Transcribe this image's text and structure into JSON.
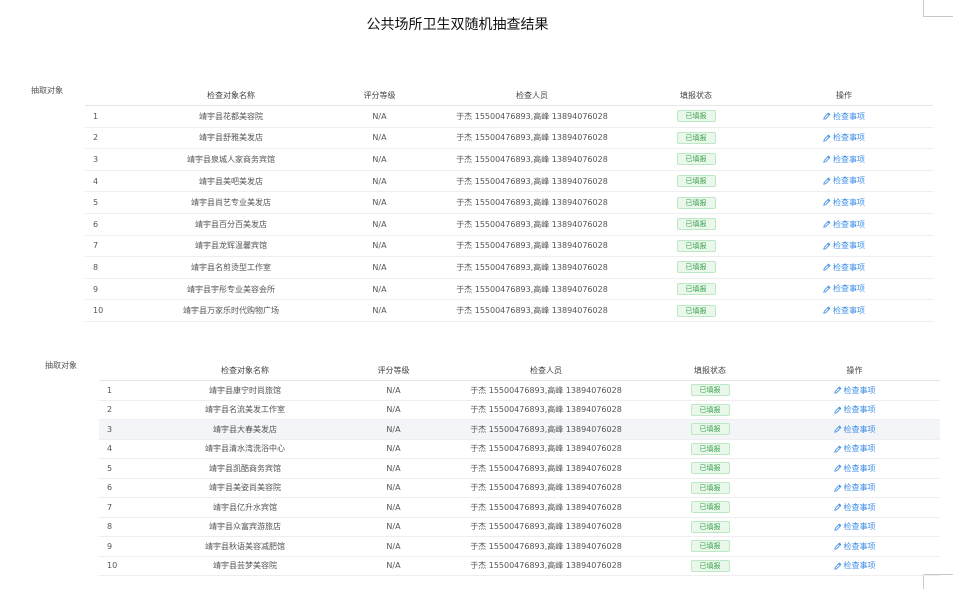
{
  "doc_title": "公共场所卫生双随机抽查结果",
  "edit_icon": "edit-icon",
  "tables": [
    {
      "label": "抽取对象",
      "headers": [
        "",
        "检查对象名称",
        "评分等级",
        "检查人员",
        "填报状态",
        "操作"
      ],
      "rows": [
        {
          "no": "1",
          "name": "靖宇县花都美容院",
          "grade": "N/A",
          "inspectors": "于杰 15500476893,高峰 13894076028",
          "status": "已填报",
          "action": "检查事项"
        },
        {
          "no": "2",
          "name": "靖宇县舒雅美发店",
          "grade": "N/A",
          "inspectors": "于杰 15500476893,高峰 13894076028",
          "status": "已填报",
          "action": "检查事项"
        },
        {
          "no": "3",
          "name": "靖宇县泉城人家商务宾馆",
          "grade": "N/A",
          "inspectors": "于杰 15500476893,高峰 13894076028",
          "status": "已填报",
          "action": "检查事项"
        },
        {
          "no": "4",
          "name": "靖宇县美吧美发店",
          "grade": "N/A",
          "inspectors": "于杰 15500476893,高峰 13894076028",
          "status": "已填报",
          "action": "检查事项"
        },
        {
          "no": "5",
          "name": "靖宇县尚艺专业美发店",
          "grade": "N/A",
          "inspectors": "于杰 15500476893,高峰 13894076028",
          "status": "已填报",
          "action": "检查事项"
        },
        {
          "no": "6",
          "name": "靖宇县百分百美发店",
          "grade": "N/A",
          "inspectors": "于杰 15500476893,高峰 13894076028",
          "status": "已填报",
          "action": "检查事项"
        },
        {
          "no": "7",
          "name": "靖宇县龙辉温馨宾馆",
          "grade": "N/A",
          "inspectors": "于杰 15500476893,高峰 13894076028",
          "status": "已填报",
          "action": "检查事项"
        },
        {
          "no": "8",
          "name": "靖宇县名剪烫型工作室",
          "grade": "N/A",
          "inspectors": "于杰 15500476893,高峰 13894076028",
          "status": "已填报",
          "action": "检查事项"
        },
        {
          "no": "9",
          "name": "靖宇县宇彤专业美容会所",
          "grade": "N/A",
          "inspectors": "于杰 15500476893,高峰 13894076028",
          "status": "已填报",
          "action": "检查事项"
        },
        {
          "no": "10",
          "name": "靖宇县万家乐时代购物广场",
          "grade": "N/A",
          "inspectors": "于杰 15500476893,高峰 13894076028",
          "status": "已填报",
          "action": "检查事项"
        }
      ]
    },
    {
      "label": "抽取对象",
      "headers": [
        "",
        "检查对象名称",
        "评分等级",
        "检查人员",
        "填报状态",
        "操作"
      ],
      "rows": [
        {
          "no": "1",
          "name": "靖宇县康宁时尚旅馆",
          "grade": "N/A",
          "inspectors": "于杰 15500476893,高峰 13894076028",
          "status": "已填报",
          "action": "检查事项"
        },
        {
          "no": "2",
          "name": "靖宇县名流美发工作室",
          "grade": "N/A",
          "inspectors": "于杰 15500476893,高峰 13894076028",
          "status": "已填报",
          "action": "检查事项"
        },
        {
          "no": "3",
          "name": "靖宇县大春美发店",
          "grade": "N/A",
          "inspectors": "于杰 15500476893,高峰 13894076028",
          "status": "已填报",
          "action": "检查事项"
        },
        {
          "no": "4",
          "name": "靖宇县清水湾洗浴中心",
          "grade": "N/A",
          "inspectors": "于杰 15500476893,高峰 13894076028",
          "status": "已填报",
          "action": "检查事项"
        },
        {
          "no": "5",
          "name": "靖宇县凯酷商务宾馆",
          "grade": "N/A",
          "inspectors": "于杰 15500476893,高峰 13894076028",
          "status": "已填报",
          "action": "检查事项"
        },
        {
          "no": "6",
          "name": "靖宇县美姿尚美容院",
          "grade": "N/A",
          "inspectors": "于杰 15500476893,高峰 13894076028",
          "status": "已填报",
          "action": "检查事项"
        },
        {
          "no": "7",
          "name": "靖宇县亿升水宾馆",
          "grade": "N/A",
          "inspectors": "于杰 15500476893,高峰 13894076028",
          "status": "已填报",
          "action": "检查事项"
        },
        {
          "no": "8",
          "name": "靖宇县众富宾游旅店",
          "grade": "N/A",
          "inspectors": "于杰 15500476893,高峰 13894076028",
          "status": "已填报",
          "action": "检查事项"
        },
        {
          "no": "9",
          "name": "靖宇县秋语美容减肥馆",
          "grade": "N/A",
          "inspectors": "于杰 15500476893,高峰 13894076028",
          "status": "已填报",
          "action": "检查事项"
        },
        {
          "no": "10",
          "name": "靖宇县芸梦美容院",
          "grade": "N/A",
          "inspectors": "于杰 15500476893,高峰 13894076028",
          "status": "已填报",
          "action": "检查事项"
        }
      ]
    }
  ]
}
